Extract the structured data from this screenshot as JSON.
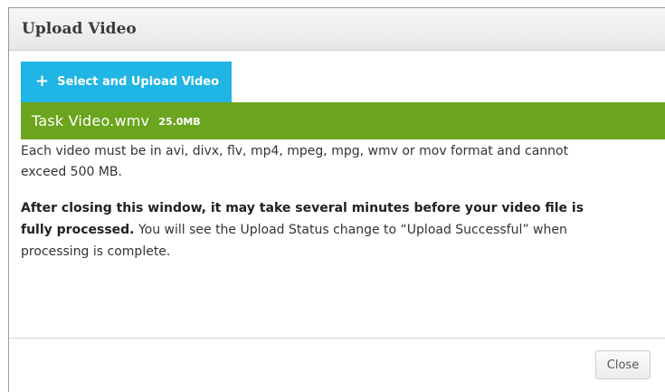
{
  "dialog": {
    "title": "Upload Video"
  },
  "upload": {
    "button_icon": "+",
    "button_label": "Select and Upload Video"
  },
  "file": {
    "name": "Task Video.wmv",
    "size": "25.0MB"
  },
  "info": {
    "formats_text": "Each video must be in avi, divx, flv, mp4, mpeg, mpg, wmv or mov format and cannot exceed 500 MB.",
    "notice_bold": "After closing this window, it may take several minutes before your video file is fully processed.",
    "notice_rest": " You will see the Upload Status change to “Upload Successful” when processing is complete."
  },
  "footer": {
    "close_label": "Close"
  },
  "colors": {
    "upload_button": "#1fb5e5",
    "file_bar": "#6ba51e",
    "header_bg": "#efefef"
  }
}
